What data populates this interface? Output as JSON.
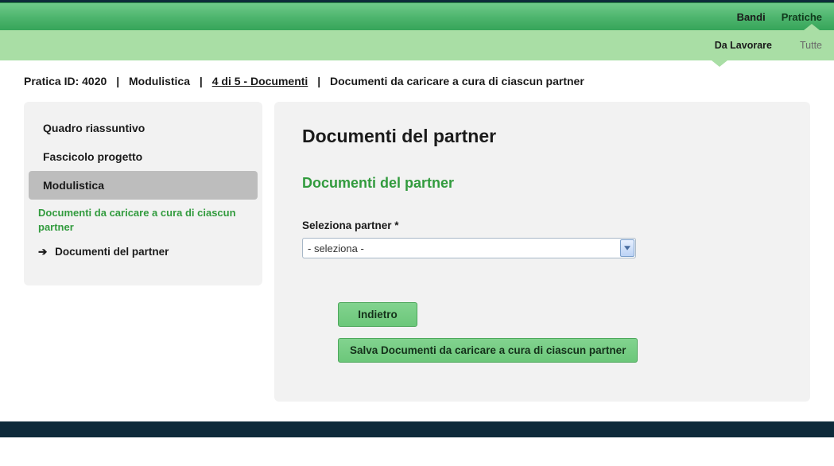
{
  "topnav": {
    "bandi": "Bandi",
    "pratiche": "Pratiche"
  },
  "subnav": {
    "da_lavorare": "Da Lavorare",
    "tutte": "Tutte"
  },
  "breadcrumb": {
    "pratica_id_label": "Pratica ID: 4020",
    "modulistica": "Modulistica",
    "step": "4 di 5 - Documenti",
    "current": "Documenti da caricare a cura di ciascun partner"
  },
  "sidebar": {
    "items": [
      {
        "label": "Quadro riassuntivo"
      },
      {
        "label": "Fascicolo progetto"
      },
      {
        "label": "Modulistica"
      }
    ],
    "sub": "Documenti da caricare a cura di ciascun partner",
    "leaf": "Documenti del partner"
  },
  "main": {
    "title": "Documenti del partner",
    "section": "Documenti del partner",
    "field_label": "Seleziona partner *",
    "select_placeholder": "- seleziona -",
    "btn_back": "Indietro",
    "btn_save": "Salva Documenti da caricare a cura di ciascun partner"
  }
}
